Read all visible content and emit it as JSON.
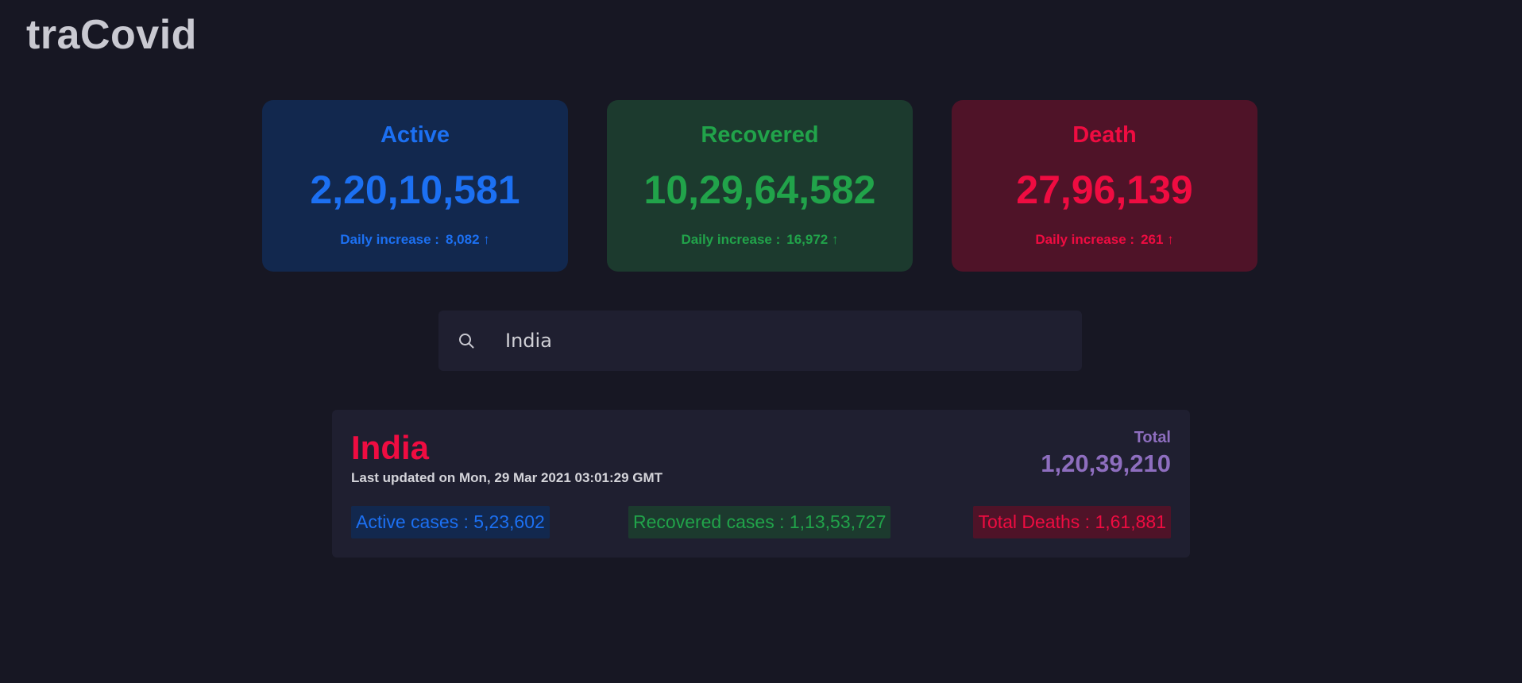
{
  "brand": {
    "title": "traCovid"
  },
  "stats": {
    "active": {
      "label": "Active",
      "count": "2,20,10,581",
      "daily_label": "Daily increase :",
      "daily_value": "8,082",
      "arrow": "↑",
      "color": "#1c70f2"
    },
    "recovered": {
      "label": "Recovered",
      "count": "10,29,64,582",
      "daily_label": "Daily increase :",
      "daily_value": "16,972",
      "arrow": "↑",
      "color": "#21a34a"
    },
    "death": {
      "label": "Death",
      "count": "27,96,139",
      "daily_label": "Daily increase :",
      "daily_value": "261",
      "arrow": "↑",
      "color": "#ef0c41"
    }
  },
  "search": {
    "icon": "search-icon",
    "value": "India"
  },
  "result": {
    "country": "India",
    "updated": "Last updated on Mon, 29 Mar 2021 03:01:29 GMT",
    "total_label": "Total",
    "total_value": "1,20,39,210",
    "active_cases": "Active cases : 5,23,602",
    "recovered_cases": "Recovered cases : 1,13,53,727",
    "total_deaths": "Total Deaths : 1,61,881"
  }
}
